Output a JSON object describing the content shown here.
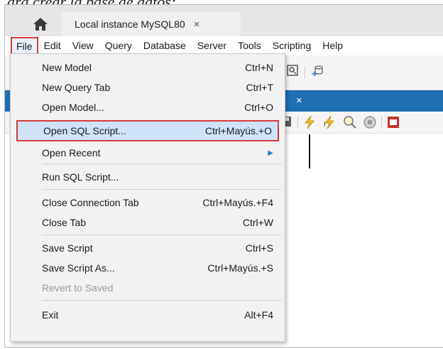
{
  "caption": "ara crear la base de datos:",
  "app": {
    "home_icon": "home-icon",
    "connection_tab": {
      "label": "Local instance MySQL80",
      "close": "×"
    }
  },
  "menubar": {
    "items": [
      "File",
      "Edit",
      "View",
      "Query",
      "Database",
      "Server",
      "Tools",
      "Scripting",
      "Help"
    ]
  },
  "query_tab": {
    "close": "×"
  },
  "file_menu": {
    "items": [
      {
        "label": "New Model",
        "shortcut": "Ctrl+N"
      },
      {
        "label": "New Query Tab",
        "shortcut": "Ctrl+T"
      },
      {
        "label": "Open Model...",
        "shortcut": "Ctrl+O"
      },
      {
        "label": "Open SQL Script...",
        "shortcut": "Ctrl+Mayús.+O"
      },
      {
        "label": "Open Recent",
        "shortcut": ""
      },
      {
        "label": "Run SQL Script...",
        "shortcut": ""
      },
      {
        "label": "Close Connection Tab",
        "shortcut": "Ctrl+Mayús.+F4"
      },
      {
        "label": "Close Tab",
        "shortcut": "Ctrl+W"
      },
      {
        "label": "Save Script",
        "shortcut": "Ctrl+S"
      },
      {
        "label": "Save Script As...",
        "shortcut": "Ctrl+Mayús.+S"
      },
      {
        "label": "Revert to Saved",
        "shortcut": ""
      },
      {
        "label": "Exit",
        "shortcut": "Alt+F4"
      }
    ],
    "submenu_arrow": "▶"
  },
  "colors": {
    "highlight_box": "#d43b3b",
    "selected_bg": "#cfe3f8",
    "query_tab_bar": "#1f6fb5"
  }
}
